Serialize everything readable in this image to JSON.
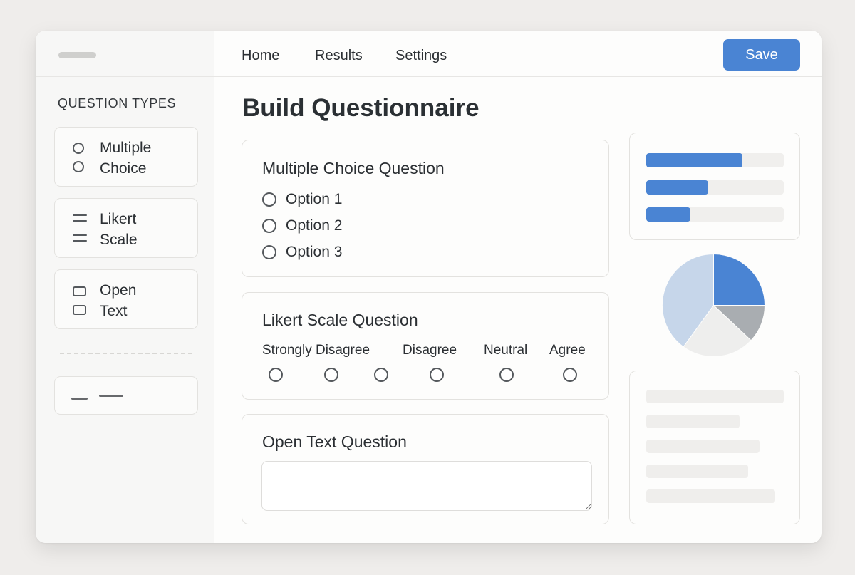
{
  "nav": {
    "items": [
      {
        "label": "Home"
      },
      {
        "label": "Results"
      },
      {
        "label": "Settings"
      }
    ],
    "save_label": "Save"
  },
  "sidebar": {
    "title": "QUESTION TYPES",
    "types": [
      {
        "line1": "Multiple",
        "line2": "Choice",
        "icon": "radio-circles-icon"
      },
      {
        "line1": "Likert",
        "line2": "Scale",
        "icon": "scale-lines-icon"
      },
      {
        "line1": "Open",
        "line2": "Text",
        "icon": "text-box-icon"
      }
    ]
  },
  "main": {
    "title": "Build Questionnaire",
    "multiple_choice": {
      "title": "Multiple Choice Question",
      "options": [
        "Option 1",
        "Option 2",
        "Option 3"
      ]
    },
    "likert": {
      "title": "Likert Scale Question",
      "labels": [
        "Strongly Disagree",
        "Disagree",
        "Neutral",
        "Agree"
      ],
      "radio_count": 6
    },
    "open_text": {
      "title": "Open Text Question",
      "value": "",
      "placeholder": ""
    }
  },
  "preview": {
    "bars": [
      0.7,
      0.45,
      0.32
    ],
    "pie": [
      {
        "value": 25,
        "color": "#4a84d3"
      },
      {
        "value": 12,
        "color": "#a9adb1"
      },
      {
        "value": 23,
        "color": "#eeeeed"
      },
      {
        "value": 40,
        "color": "#c6d6ea"
      }
    ]
  },
  "colors": {
    "accent": "#4a84d3"
  }
}
